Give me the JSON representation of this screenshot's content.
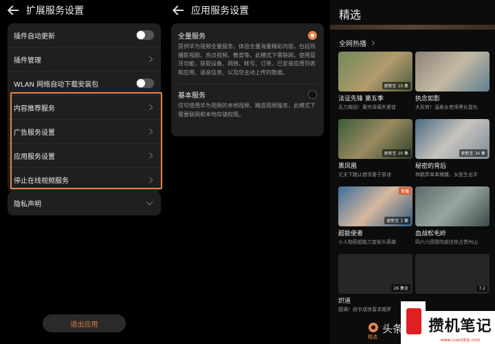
{
  "panel1": {
    "title": "扩展服务设置",
    "card1": [
      {
        "label": "插件自动更新",
        "control": "toggle"
      },
      {
        "label": "插件管理",
        "control": "chevron"
      },
      {
        "label": "WLAN 网络自动下载安装包",
        "control": "toggle"
      },
      {
        "label": "内容推荐服务",
        "control": "chevron"
      },
      {
        "label": "广告服务设置",
        "control": "chevron"
      },
      {
        "label": "应用服务设置",
        "control": "chevron"
      },
      {
        "label": "停止在线视频服务",
        "control": "chevron"
      }
    ],
    "privacy": "隐私声明",
    "exit_button": "退出应用",
    "highlight_color": "#e8874a"
  },
  "panel2": {
    "title": "应用服务设置",
    "full": {
      "label": "全量服务",
      "desc": "提供华为视频全量服务，体验全量海量精彩内容。包括热播影视剧、热点视频、教育等。此模式下需联网，使用蓝牙功能，获取设备、网络、帐号、订单、已安装应用列表和应用、语音信息、以及您主动上传的数据。",
      "selected": true
    },
    "basic": {
      "label": "基本服务",
      "desc": "仅可使用华为视频的本地视频、精选视频服务，此模式下需要联网和本地存储权限。",
      "selected": false
    }
  },
  "panel3": {
    "title": "精选",
    "section": "全网热播",
    "tiles": [
      {
        "name": "法证先锋 第五季",
        "desc": "无力挽回！黄宗泽痛失爱徒",
        "badge": "更新至 10 集",
        "live": ""
      },
      {
        "name": "执念如影",
        "desc": "大反转！温柔女老师黑化复仇",
        "badge": "",
        "live": ""
      },
      {
        "name": "黑凤凰",
        "desc": "丈夫下跪认错求妻子原谅",
        "badge": "更新至 20 集",
        "live": ""
      },
      {
        "name": "秘密的背后",
        "desc": "林鹏弄单单撑腰，女医生出手",
        "badge": "更新至 34 集",
        "live": ""
      },
      {
        "name": "超能使者",
        "desc": "小人物获超能力变街头英雄",
        "badge": "更新至 1 集",
        "live": "首播"
      },
      {
        "name": "血战松毛岭",
        "desc": "四六六团冒险前往抢占贵州山",
        "badge": "",
        "live": ""
      },
      {
        "name": "炽道",
        "desc": "圆满！段宇成惊喜求婚罗",
        "badge": "26 集全",
        "live": ""
      },
      {
        "name": "",
        "desc": "",
        "badge": "7.2",
        "live": ""
      }
    ],
    "tab_label": "精选",
    "tab_text": "头条"
  },
  "watermark": {
    "main": "攒机笔记",
    "url": "www.cuanjibiji.com"
  }
}
